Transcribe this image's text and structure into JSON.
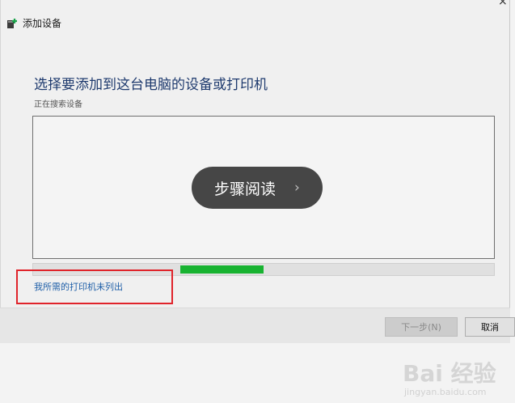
{
  "window": {
    "title": "添加设备",
    "close_glyph": "×",
    "heading": "选择要添加到这台电脑的设备或打印机",
    "status": "正在搜索设备",
    "not_listed_link": "我所需的打印机未列出",
    "progress": 0.18,
    "buttons": {
      "next": "下一步(N)",
      "cancel": "取消"
    }
  },
  "overlay": {
    "label": "步骤阅读",
    "chevron": "›"
  },
  "watermark": {
    "text": "Bai 经验",
    "sub": "jingyan.baidu.com"
  },
  "colors": {
    "heading": "#1e3a6e",
    "link": "#1f5fa8",
    "progress": "#18b331",
    "highlight": "#e0242b"
  },
  "icons": {
    "app": "add-device-icon"
  }
}
